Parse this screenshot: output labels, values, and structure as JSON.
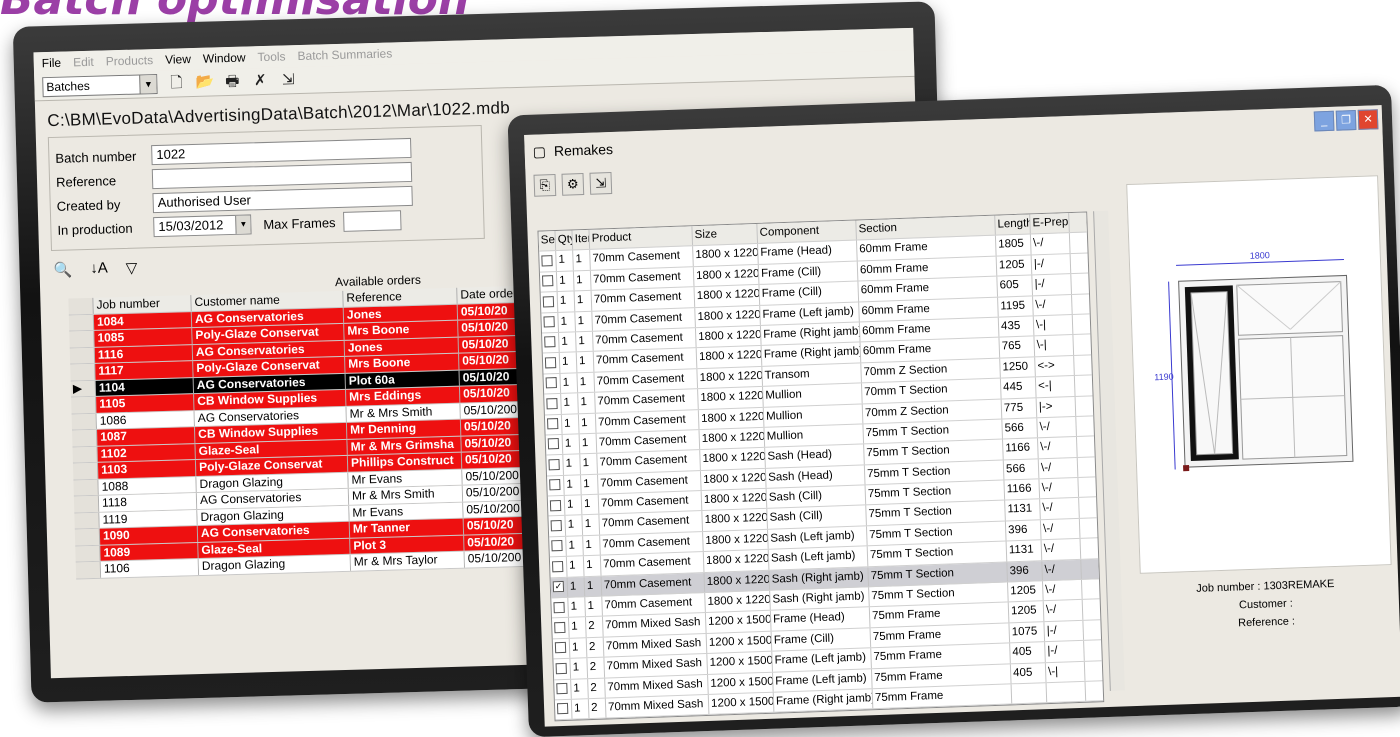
{
  "heading": "Batch optimisation",
  "left_window": {
    "menu": [
      {
        "label": "File",
        "enabled": true
      },
      {
        "label": "Edit",
        "enabled": false
      },
      {
        "label": "Products",
        "enabled": false
      },
      {
        "label": "View",
        "enabled": true
      },
      {
        "label": "Window",
        "enabled": true
      },
      {
        "label": "Tools",
        "enabled": false
      },
      {
        "label": "Batch Summaries",
        "enabled": false
      }
    ],
    "toolbar": {
      "combo_value": "Batches"
    },
    "path": "C:\\BM\\EvoData\\AdvertisingData\\Batch\\2012\\Mar\\1022.mdb",
    "form": {
      "batch_number_label": "Batch number",
      "batch_number": "1022",
      "reference_label": "Reference",
      "reference": "",
      "created_by_label": "Created by",
      "created_by": "Authorised User",
      "in_production_label": "In production",
      "in_production": "15/03/2012",
      "max_frames_label": "Max Frames",
      "max_frames": ""
    },
    "orders": {
      "caption": "Available orders",
      "columns": [
        "Job number",
        "Customer name",
        "Reference",
        "Date order"
      ],
      "rows": [
        {
          "job": "1084",
          "customer": "AG Conservatories",
          "ref": "Jones",
          "date": "05/10/20",
          "style": "red"
        },
        {
          "job": "1085",
          "customer": "Poly-Glaze Conservat",
          "ref": "Mrs Boone",
          "date": "05/10/20",
          "style": "red"
        },
        {
          "job": "1116",
          "customer": "AG Conservatories",
          "ref": "Jones",
          "date": "05/10/20",
          "style": "red"
        },
        {
          "job": "1117",
          "customer": "Poly-Glaze Conservat",
          "ref": "Mrs Boone",
          "date": "05/10/20",
          "style": "red"
        },
        {
          "job": "1104",
          "customer": "AG Conservatories",
          "ref": "Plot 60a",
          "date": "05/10/20",
          "style": "blk",
          "current": true
        },
        {
          "job": "1105",
          "customer": "CB Window Supplies",
          "ref": "Mrs Eddings",
          "date": "05/10/20",
          "style": "red"
        },
        {
          "job": "1086",
          "customer": "AG Conservatories",
          "ref": "Mr & Mrs Smith",
          "date": "05/10/200",
          "style": "wht"
        },
        {
          "job": "1087",
          "customer": "CB Window Supplies",
          "ref": "Mr Denning",
          "date": "05/10/20",
          "style": "red"
        },
        {
          "job": "1102",
          "customer": "Glaze-Seal",
          "ref": "Mr & Mrs Grimsha",
          "date": "05/10/20",
          "style": "red"
        },
        {
          "job": "1103",
          "customer": "Poly-Glaze Conservat",
          "ref": "Phillips Construct",
          "date": "05/10/20",
          "style": "red"
        },
        {
          "job": "1088",
          "customer": "Dragon Glazing",
          "ref": "Mr Evans",
          "date": "05/10/200",
          "style": "wht"
        },
        {
          "job": "1118",
          "customer": "AG Conservatories",
          "ref": "Mr & Mrs Smith",
          "date": "05/10/200",
          "style": "wht"
        },
        {
          "job": "1119",
          "customer": "Dragon Glazing",
          "ref": "Mr Evans",
          "date": "05/10/200",
          "style": "wht"
        },
        {
          "job": "1090",
          "customer": "AG Conservatories",
          "ref": "Mr Tanner",
          "date": "05/10/20",
          "style": "red"
        },
        {
          "job": "1089",
          "customer": "Glaze-Seal",
          "ref": "Plot 3",
          "date": "05/10/20",
          "style": "red"
        },
        {
          "job": "1106",
          "customer": "Dragon Glazing",
          "ref": "Mr & Mrs Taylor",
          "date": "05/10/200",
          "style": "wht"
        }
      ]
    }
  },
  "right_window": {
    "title": "Remakes",
    "columns": [
      "Sel",
      "Qty",
      "Item",
      "Product",
      "Size",
      "Component",
      "Section",
      "Length",
      "E-Prep"
    ],
    "rows": [
      {
        "checked": false,
        "qty": "1",
        "item": "1",
        "product": "70mm Casement",
        "size": "1800 x 1220",
        "component": "Frame (Head)",
        "section": "60mm Frame",
        "length": "1805",
        "eprep": "\\-/"
      },
      {
        "checked": false,
        "qty": "1",
        "item": "1",
        "product": "70mm Casement",
        "size": "1800 x 1220",
        "component": "Frame (Cill)",
        "section": "60mm Frame",
        "length": "1205",
        "eprep": "|-/"
      },
      {
        "checked": false,
        "qty": "1",
        "item": "1",
        "product": "70mm Casement",
        "size": "1800 x 1220",
        "component": "Frame (Cill)",
        "section": "60mm Frame",
        "length": "605",
        "eprep": "|-/"
      },
      {
        "checked": false,
        "qty": "1",
        "item": "1",
        "product": "70mm Casement",
        "size": "1800 x 1220",
        "component": "Frame (Left jamb)",
        "section": "60mm Frame",
        "length": "1195",
        "eprep": "\\-/"
      },
      {
        "checked": false,
        "qty": "1",
        "item": "1",
        "product": "70mm Casement",
        "size": "1800 x 1220",
        "component": "Frame (Right jamb)",
        "section": "60mm Frame",
        "length": "435",
        "eprep": "\\-|"
      },
      {
        "checked": false,
        "qty": "1",
        "item": "1",
        "product": "70mm Casement",
        "size": "1800 x 1220",
        "component": "Frame (Right jamb)",
        "section": "60mm Frame",
        "length": "765",
        "eprep": "\\-|"
      },
      {
        "checked": false,
        "qty": "1",
        "item": "1",
        "product": "70mm Casement",
        "size": "1800 x 1220",
        "component": "Transom",
        "section": "70mm Z Section",
        "length": "1250",
        "eprep": "<->"
      },
      {
        "checked": false,
        "qty": "1",
        "item": "1",
        "product": "70mm Casement",
        "size": "1800 x 1220",
        "component": "Mullion",
        "section": "70mm T Section",
        "length": "445",
        "eprep": "<-|"
      },
      {
        "checked": false,
        "qty": "1",
        "item": "1",
        "product": "70mm Casement",
        "size": "1800 x 1220",
        "component": "Mullion",
        "section": "70mm Z Section",
        "length": "775",
        "eprep": "|->"
      },
      {
        "checked": false,
        "qty": "1",
        "item": "1",
        "product": "70mm Casement",
        "size": "1800 x 1220",
        "component": "Mullion",
        "section": "75mm T Section",
        "length": "566",
        "eprep": "\\-/"
      },
      {
        "checked": false,
        "qty": "1",
        "item": "1",
        "product": "70mm Casement",
        "size": "1800 x 1220",
        "component": "Sash (Head)",
        "section": "75mm T Section",
        "length": "1166",
        "eprep": "\\-/"
      },
      {
        "checked": false,
        "qty": "1",
        "item": "1",
        "product": "70mm Casement",
        "size": "1800 x 1220",
        "component": "Sash (Head)",
        "section": "75mm T Section",
        "length": "566",
        "eprep": "\\-/"
      },
      {
        "checked": false,
        "qty": "1",
        "item": "1",
        "product": "70mm Casement",
        "size": "1800 x 1220",
        "component": "Sash (Cill)",
        "section": "75mm T Section",
        "length": "1166",
        "eprep": "\\-/"
      },
      {
        "checked": false,
        "qty": "1",
        "item": "1",
        "product": "70mm Casement",
        "size": "1800 x 1220",
        "component": "Sash (Cill)",
        "section": "75mm T Section",
        "length": "1131",
        "eprep": "\\-/"
      },
      {
        "checked": false,
        "qty": "1",
        "item": "1",
        "product": "70mm Casement",
        "size": "1800 x 1220",
        "component": "Sash (Left jamb)",
        "section": "75mm T Section",
        "length": "396",
        "eprep": "\\-/"
      },
      {
        "checked": false,
        "qty": "1",
        "item": "1",
        "product": "70mm Casement",
        "size": "1800 x 1220",
        "component": "Sash (Left jamb)",
        "section": "75mm T Section",
        "length": "1131",
        "eprep": "\\-/"
      },
      {
        "checked": true,
        "qty": "1",
        "item": "1",
        "product": "70mm Casement",
        "size": "1800 x 1220",
        "component": "Sash (Right jamb)",
        "section": "75mm T Section",
        "length": "396",
        "eprep": "\\-/",
        "selected": true
      },
      {
        "checked": false,
        "qty": "1",
        "item": "1",
        "product": "70mm Casement",
        "size": "1800 x 1220",
        "component": "Sash (Right jamb)",
        "section": "75mm T Section",
        "length": "1205",
        "eprep": "\\-/"
      },
      {
        "checked": false,
        "qty": "1",
        "item": "2",
        "product": "70mm Mixed Sash",
        "size": "1200 x 1500",
        "component": "Frame (Head)",
        "section": "75mm Frame",
        "length": "1205",
        "eprep": "\\-/"
      },
      {
        "checked": false,
        "qty": "1",
        "item": "2",
        "product": "70mm Mixed Sash",
        "size": "1200 x 1500",
        "component": "Frame (Cill)",
        "section": "75mm Frame",
        "length": "1075",
        "eprep": "|-/"
      },
      {
        "checked": false,
        "qty": "1",
        "item": "2",
        "product": "70mm Mixed Sash",
        "size": "1200 x 1500",
        "component": "Frame (Left jamb)",
        "section": "75mm Frame",
        "length": "405",
        "eprep": "|-/"
      },
      {
        "checked": false,
        "qty": "1",
        "item": "2",
        "product": "70mm Mixed Sash",
        "size": "1200 x 1500",
        "component": "Frame (Left jamb)",
        "section": "75mm Frame",
        "length": "405",
        "eprep": "\\-|"
      },
      {
        "checked": false,
        "qty": "1",
        "item": "2",
        "product": "70mm Mixed Sash",
        "size": "1200 x 1500",
        "component": "Frame (Right jamb)",
        "section": "75mm Frame",
        "length": "",
        "eprep": ""
      }
    ],
    "preview": {
      "width_dim": "1800",
      "height_dim": "1190"
    },
    "info": {
      "job_number": "Job number : 1303REMAKE",
      "customer": "Customer :",
      "reference": "Reference :"
    }
  }
}
